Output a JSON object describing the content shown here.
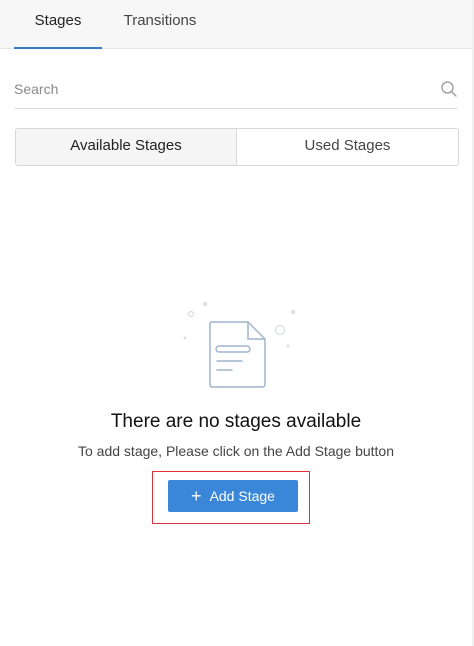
{
  "tabs": {
    "stages": "Stages",
    "transitions": "Transitions"
  },
  "search": {
    "placeholder": "Search",
    "icon": "search-icon"
  },
  "segment": {
    "available": "Available Stages",
    "used": "Used Stages",
    "active": "Available Stages"
  },
  "empty_state": {
    "icon": "document-icon",
    "title": "There are no stages available",
    "subtitle": "To add stage, Please click on the Add Stage button",
    "button_label": "Add Stage",
    "button_icon": "plus-icon"
  },
  "colors": {
    "accent": "#3a86d8",
    "highlight_border": "#e0323c",
    "tab_underline": "#3b7ac8"
  }
}
